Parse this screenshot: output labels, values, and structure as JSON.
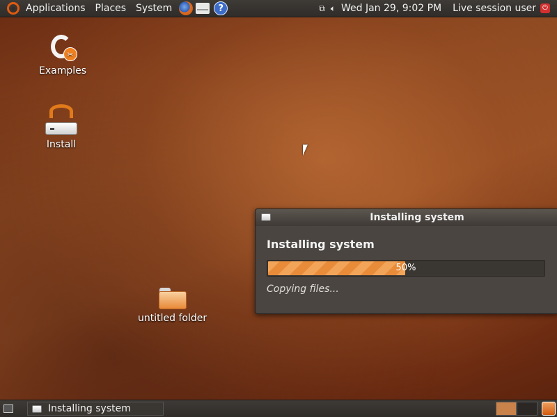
{
  "top_panel": {
    "menus": [
      "Applications",
      "Places",
      "System"
    ],
    "launchers": [
      "firefox-icon",
      "mail-icon",
      "help-icon"
    ],
    "clock": "Wed Jan 29,  9:02 PM",
    "user": "Live session user"
  },
  "desktop": {
    "icons": [
      {
        "label": "Examples"
      },
      {
        "label": "Install"
      },
      {
        "label": "untitled folder"
      }
    ]
  },
  "dialog": {
    "title": "Installing system",
    "heading": "Installing system",
    "progress_value": 50,
    "progress_text": "50%",
    "status": "Copying files..."
  },
  "bottom_panel": {
    "task": "Installing system"
  },
  "colors": {
    "accent": "#e88c3a",
    "panel": "#3e3b37"
  }
}
